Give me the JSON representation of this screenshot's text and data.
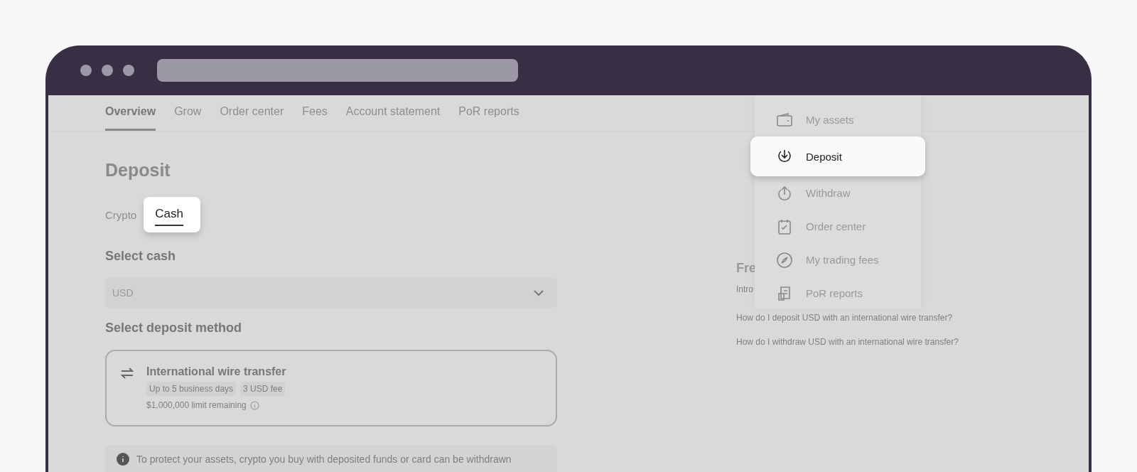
{
  "nav_tabs": [
    {
      "label": "Overview",
      "selected": true
    },
    {
      "label": "Grow",
      "selected": false
    },
    {
      "label": "Order center",
      "selected": false
    },
    {
      "label": "Fees",
      "selected": false
    },
    {
      "label": "Account statement",
      "selected": false
    },
    {
      "label": "PoR reports",
      "selected": false
    }
  ],
  "title": "Deposit",
  "type_tabs": [
    {
      "label": "Crypto",
      "selected": false
    },
    {
      "label": "Cash",
      "selected": true
    }
  ],
  "select_cash": {
    "label": "Select cash",
    "value": "USD"
  },
  "deposit_method": {
    "label": "Select deposit method",
    "title": "International wire transfer",
    "tags": [
      "Up to 5 business days",
      "3 USD fee"
    ],
    "limit": "$1,000,000 limit remaining"
  },
  "notice": "To protect your assets, crypto you buy with deposited funds or card can be withdrawn",
  "faq": {
    "title": "Fre",
    "items": [
      "Intro",
      "How do I deposit USD with an international wire transfer?",
      "How do I withdraw USD with an international wire transfer?"
    ]
  },
  "menu": [
    {
      "label": "My assets",
      "selected": false
    },
    {
      "label": "Deposit",
      "selected": true
    },
    {
      "label": "Withdraw",
      "selected": false
    },
    {
      "label": "Order center",
      "selected": false
    },
    {
      "label": "My trading fees",
      "selected": false
    },
    {
      "label": "PoR reports",
      "selected": false
    }
  ]
}
